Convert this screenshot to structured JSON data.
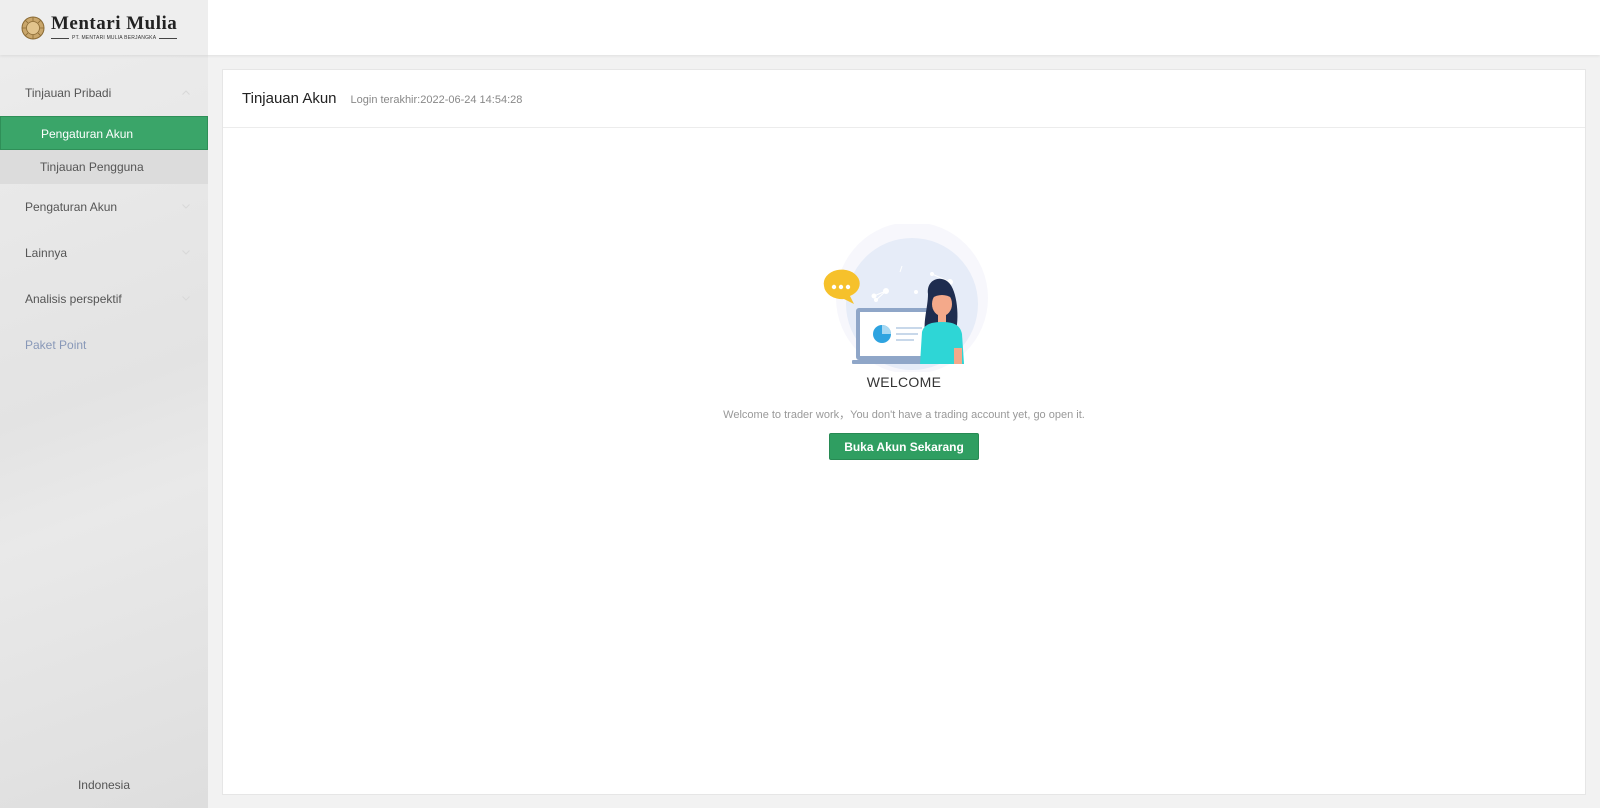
{
  "brand": {
    "name": "Mentari Mulia",
    "subtitle": "PT. MENTARI MULIA BERJANGKA"
  },
  "sidebar": {
    "items": [
      {
        "label": "Tinjauan Pribadi",
        "expandable": true
      },
      {
        "label": "Pengaturan Akun",
        "expandable": true
      },
      {
        "label": "Lainnya",
        "expandable": true
      },
      {
        "label": "Analisis perspektif",
        "expandable": true
      },
      {
        "label": "Paket Point",
        "expandable": false
      }
    ],
    "subitems": [
      {
        "label": "Pengaturan Akun",
        "active": true
      },
      {
        "label": "Tinjauan Pengguna",
        "active": false
      }
    ],
    "language": "Indonesia"
  },
  "main": {
    "title": "Tinjauan Akun",
    "last_login": "Login terakhir:2022-06-24 14:54:28",
    "welcome_title": "WELCOME",
    "welcome_text": "Welcome to trader work，You don't have a trading account yet, go open it.",
    "open_button": "Buka Akun Sekarang"
  },
  "colors": {
    "accent": "#3aa569",
    "button": "#2f9e61",
    "sidebar_bg": "#e6e6e6",
    "paket_point_text": "#8898b8"
  }
}
